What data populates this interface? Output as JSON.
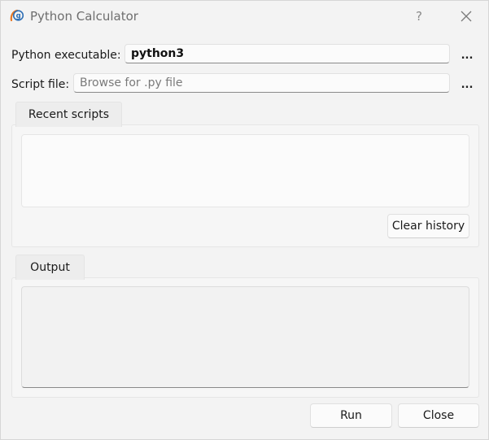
{
  "window": {
    "title": "Python Calculator",
    "help_label": "?"
  },
  "form": {
    "python_label": "Python executable:",
    "python_value": "python3",
    "script_label": "Script file:",
    "script_placeholder": "Browse for .py file",
    "browse_label": "..."
  },
  "recent": {
    "tab_label": "Recent scripts",
    "clear_label": "Clear history",
    "items": []
  },
  "output": {
    "tab_label": "Output",
    "text": ""
  },
  "footer": {
    "run_label": "Run",
    "close_label": "Close"
  },
  "colors": {
    "icon_orange": "#e87722",
    "icon_blue": "#2f6fb5"
  }
}
